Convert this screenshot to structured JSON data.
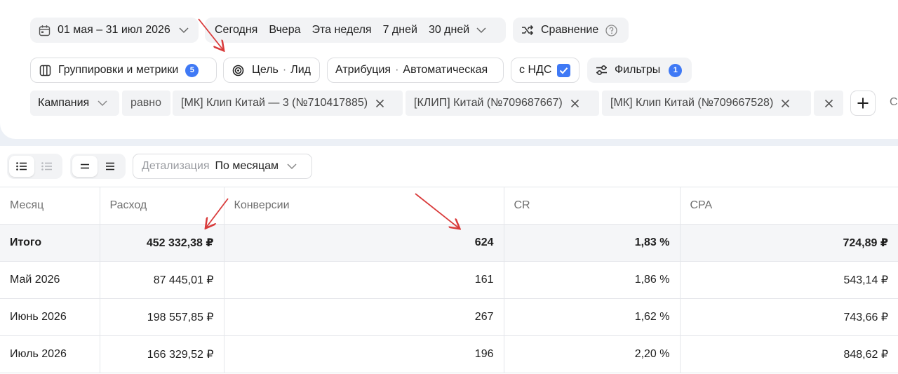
{
  "toolbar": {
    "date_range": "01 мая – 31 июл 2026",
    "presets": [
      "Сегодня",
      "Вчера",
      "Эта неделя",
      "7 дней",
      "30 дней"
    ],
    "compare_label": "Сравнение"
  },
  "settings": {
    "groupings_label": "Группировки и метрики",
    "groupings_count": "5",
    "goal_label": "Цель",
    "goal_value": "Лид",
    "attribution_label": "Атрибуция",
    "attribution_value": "Автоматическая",
    "vat_label": "с НДС",
    "vat_checked": true,
    "filters_label": "Фильтры",
    "filters_count": "1"
  },
  "filter": {
    "field": "Кампания",
    "operator": "равно",
    "values": [
      "[МК] Клип Китай — 3 (№710417885)",
      "[КЛИП] Китай (№709687667)",
      "[МК] Клип Китай (№709667528)"
    ],
    "overflow_char": "С"
  },
  "table_controls": {
    "detail_label": "Детализация",
    "detail_value": "По месяцам"
  },
  "table": {
    "headers": [
      "Месяц",
      "Расход",
      "Конверсии",
      "CR",
      "CPA"
    ],
    "total": [
      "Итого",
      "452 332,38 ₽",
      "624",
      "1,83 %",
      "724,89 ₽"
    ],
    "rows": [
      [
        "Май 2026",
        "87 445,01 ₽",
        "161",
        "1,86 %",
        "543,14 ₽"
      ],
      [
        "Июнь 2026",
        "198 557,85 ₽",
        "267",
        "1,62 %",
        "743,66 ₽"
      ],
      [
        "Июль 2026",
        "166 329,52 ₽",
        "196",
        "2,20 %",
        "848,62 ₽"
      ]
    ]
  },
  "colors": {
    "accent": "#3f79f5",
    "annotation_arrow": "#d93a3a"
  }
}
